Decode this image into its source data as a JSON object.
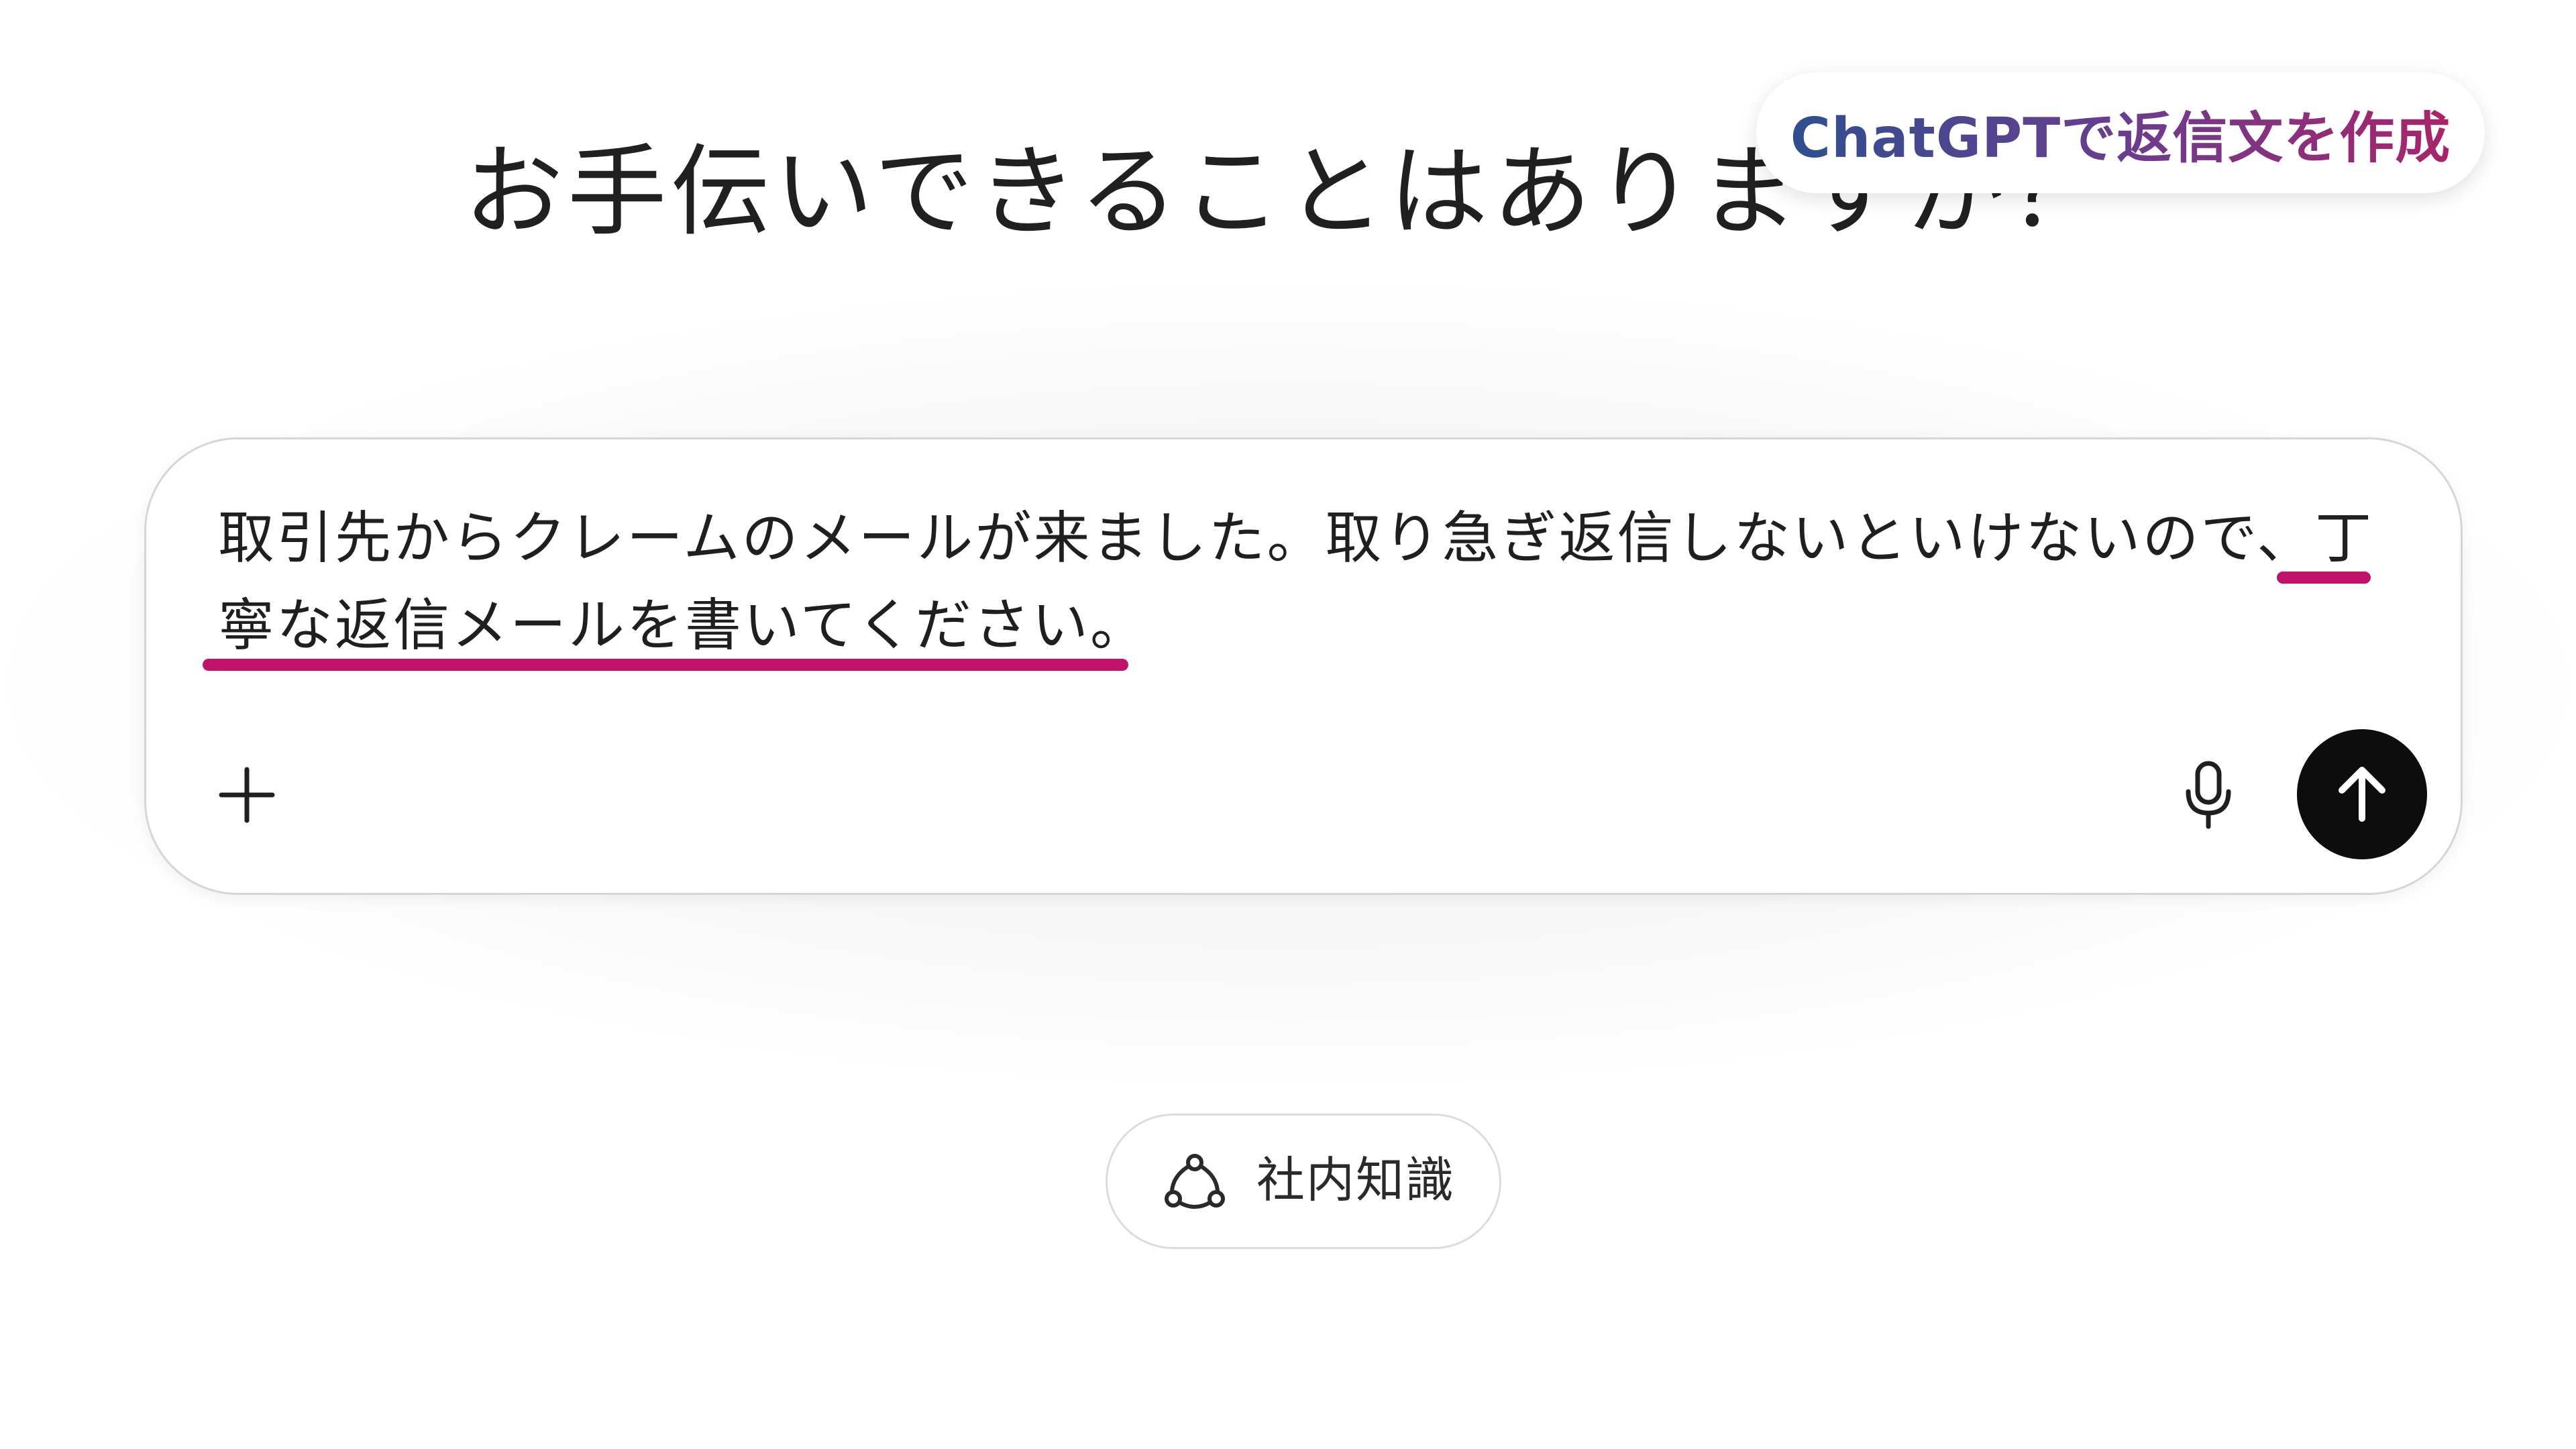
{
  "heading": "お手伝いできることはありますか？",
  "badge": {
    "text": "ChatGPTで返信文を作成",
    "colors": [
      "#2f4f8f",
      "#6a3d8f",
      "#a8246a"
    ]
  },
  "composer": {
    "prompt_line1": "取引先からクレームのメールが来ました。取り急ぎ返信しないといけないので、丁",
    "prompt_line2": "寧な返信メールを書いてください。",
    "underline_color": "#c0116b",
    "icons": {
      "attach": "plus-icon",
      "voice": "microphone-icon",
      "send": "arrow-up-icon"
    }
  },
  "chip": {
    "label": "社内知識",
    "icon": "connected-sources-icon"
  }
}
